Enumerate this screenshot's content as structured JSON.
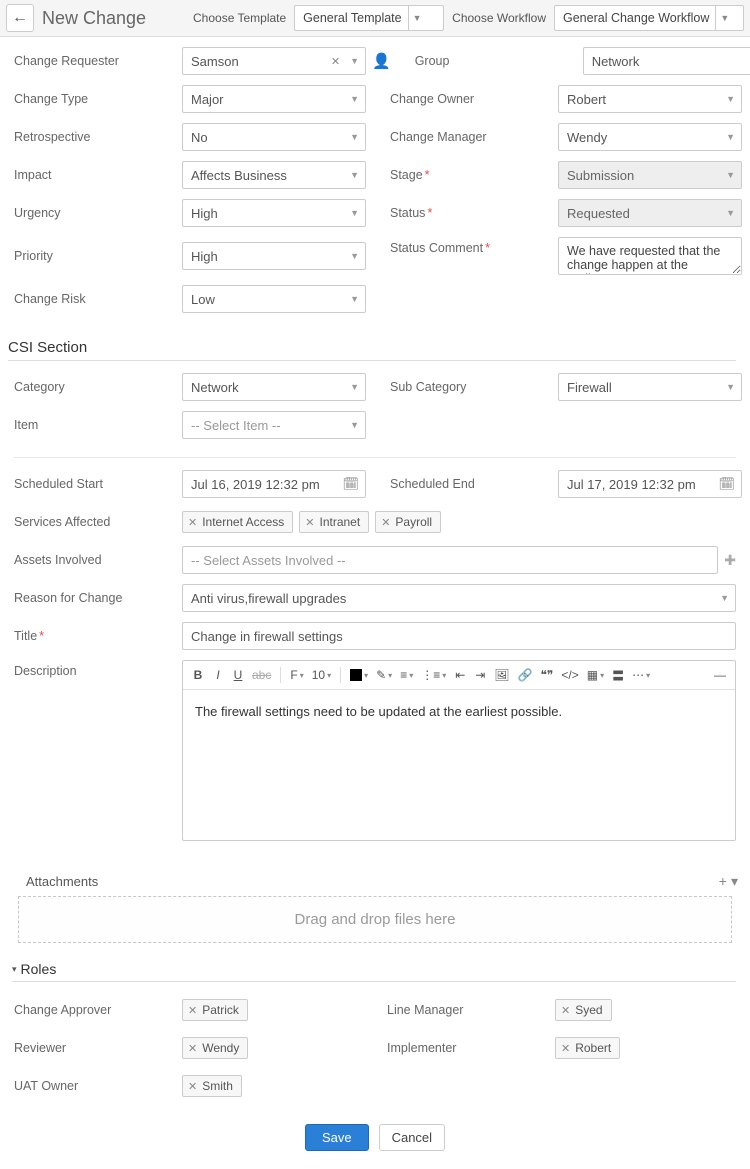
{
  "header": {
    "title": "New Change",
    "template_label": "Choose Template",
    "template_value": "General Template",
    "workflow_label": "Choose Workflow",
    "workflow_value": "General Change Workflow"
  },
  "fields": {
    "change_requester": {
      "label": "Change Requester",
      "value": "Samson"
    },
    "group": {
      "label": "Group",
      "value": "Network"
    },
    "change_type": {
      "label": "Change Type",
      "value": "Major"
    },
    "change_owner": {
      "label": "Change Owner",
      "value": "Robert"
    },
    "retrospective": {
      "label": "Retrospective",
      "value": "No"
    },
    "change_manager": {
      "label": "Change Manager",
      "value": "Wendy"
    },
    "impact": {
      "label": "Impact",
      "value": "Affects Business"
    },
    "stage": {
      "label": "Stage",
      "value": "Submission"
    },
    "urgency": {
      "label": "Urgency",
      "value": "High"
    },
    "status": {
      "label": "Status",
      "value": "Requested"
    },
    "priority": {
      "label": "Priority",
      "value": "High"
    },
    "status_comment": {
      "label": "Status Comment",
      "value": "We have requested that the change happen at the earliest."
    },
    "change_risk": {
      "label": "Change Risk",
      "value": "Low"
    }
  },
  "csi": {
    "title": "CSI Section",
    "category": {
      "label": "Category",
      "value": "Network"
    },
    "sub_category": {
      "label": "Sub Category",
      "value": "Firewall"
    },
    "item": {
      "label": "Item",
      "placeholder": "-- Select Item --"
    }
  },
  "schedule": {
    "start_label": "Scheduled Start",
    "start_value": "Jul 16, 2019 12:32 pm",
    "end_label": "Scheduled End",
    "end_value": "Jul 17, 2019 12:32 pm",
    "services_label": "Services Affected",
    "services": [
      "Internet Access",
      "Intranet",
      "Payroll"
    ],
    "assets_label": "Assets Involved",
    "assets_placeholder": "-- Select Assets Involved --",
    "reason_label": "Reason for Change",
    "reason_value": "Anti virus,firewall upgrades",
    "title_label": "Title",
    "title_value": "Change in firewall settings",
    "description_label": "Description",
    "description_value": "The firewall settings need to be updated at the earliest possible.",
    "rte_font_size": "10"
  },
  "attachments": {
    "title": "Attachments",
    "dropzone": "Drag and drop files here"
  },
  "roles": {
    "title": "Roles",
    "change_approver": {
      "label": "Change Approver",
      "value": "Patrick"
    },
    "line_manager": {
      "label": "Line Manager",
      "value": "Syed"
    },
    "reviewer": {
      "label": "Reviewer",
      "value": "Wendy"
    },
    "implementer": {
      "label": "Implementer",
      "value": "Robert"
    },
    "uat_owner": {
      "label": "UAT Owner",
      "value": "Smith"
    }
  },
  "footer": {
    "save": "Save",
    "cancel": "Cancel"
  }
}
